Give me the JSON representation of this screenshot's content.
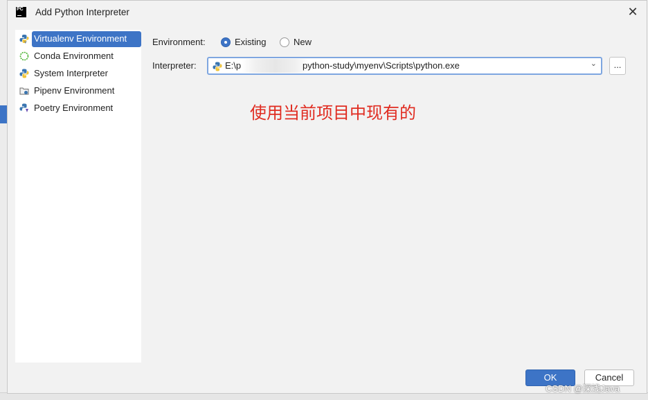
{
  "window": {
    "title": "Add Python Interpreter",
    "app_icon": "pycharm-logo",
    "app_icon_text": "PC"
  },
  "sidebar": {
    "items": [
      {
        "label": "Virtualenv Environment",
        "icon": "virtualenv-icon",
        "selected": true
      },
      {
        "label": "Conda Environment",
        "icon": "conda-icon",
        "selected": false
      },
      {
        "label": "System Interpreter",
        "icon": "python-icon",
        "selected": false
      },
      {
        "label": "Pipenv Environment",
        "icon": "pipenv-icon",
        "selected": false
      },
      {
        "label": "Poetry Environment",
        "icon": "poetry-icon",
        "selected": false
      }
    ]
  },
  "form": {
    "environment_label": "Environment:",
    "options": [
      {
        "label": "Existing",
        "checked": true
      },
      {
        "label": "New",
        "checked": false
      }
    ],
    "interpreter_label": "Interpreter:",
    "interpreter_path_start": "E:\\p",
    "interpreter_path_end": "python-study\\myenv\\Scripts\\python.exe",
    "browse_label": "..."
  },
  "annotation": "使用当前项目中现有的",
  "buttons": {
    "ok": "OK",
    "cancel": "Cancel"
  },
  "watermark": "CSDN @深浅Java",
  "colors": {
    "accent": "#3d74c6",
    "annotation": "#e02b20",
    "focus_border": "#7ea6e0"
  }
}
